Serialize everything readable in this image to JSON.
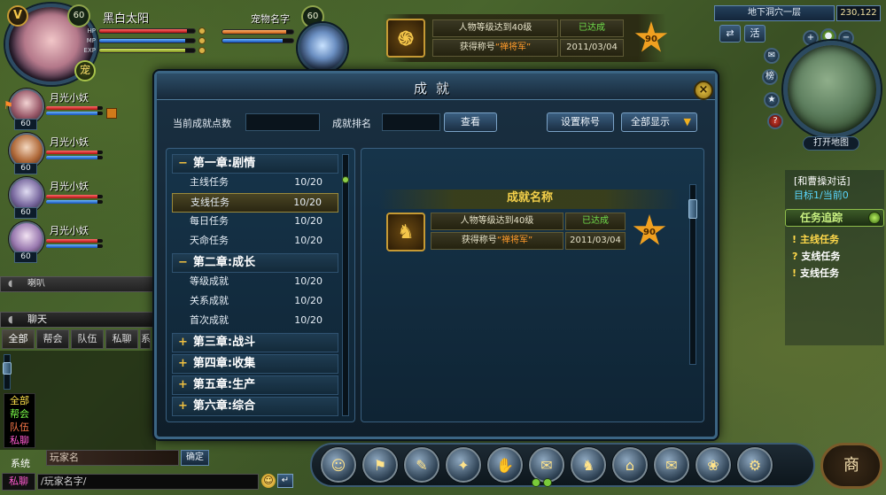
{
  "player": {
    "vip": "V",
    "level": "60",
    "name": "黑白太阳",
    "stat_labels": [
      "HP",
      "MP",
      "EXP"
    ],
    "hp_fraction": 0.92,
    "mp_fraction": 0.9,
    "exp_fraction": 0.9,
    "zhai_label": "宠"
  },
  "pet": {
    "name": "宠物名字",
    "level": "60",
    "hp_fraction": 0.9,
    "mp_fraction": 0.85
  },
  "party": [
    {
      "name": "月光小妖",
      "level": "60"
    },
    {
      "name": "月光小妖",
      "level": "60"
    },
    {
      "name": "月光小妖",
      "level": "60"
    },
    {
      "name": "月光小妖",
      "level": "60"
    }
  ],
  "notification": {
    "requirement": "人物等级达到40级",
    "status": "已达成",
    "reward_prefix": "获得称号",
    "reward_title": "“禅将军”",
    "date": "2011/03/04",
    "points": "90"
  },
  "minimap": {
    "location": "地下洞穴一层",
    "coords": "230,122",
    "button_left": "⇄",
    "button_right": "活",
    "side_buttons": [
      "榜",
      "?"
    ],
    "open_map_label": "打开地图"
  },
  "quest_tracker": {
    "talk": "[和曹操对话]",
    "target": "目标1/当前0",
    "track_label": "任务追踪",
    "items": [
      "主线任务",
      "支线任务",
      "支线任务"
    ]
  },
  "chat": {
    "collapsed_label": "喇叭",
    "header": "聊天",
    "tabs": [
      "全部",
      "帮会",
      "队伍",
      "私聊",
      "系"
    ],
    "filters": [
      {
        "label": "全部",
        "color": "#ffe14a"
      },
      {
        "label": "帮会",
        "color": "#7cff4a"
      },
      {
        "label": "队伍",
        "color": "#ff7a4a"
      },
      {
        "label": "私聊",
        "color": "#ff5ad0"
      },
      {
        "label": "系统",
        "color": "#ffffff"
      }
    ],
    "name_placeholder": "玩家名",
    "confirm_label": "确定",
    "channel_label": "私聊",
    "message_placeholder": "/玩家名字/"
  },
  "window": {
    "title": "成就",
    "points_label": "当前成就点数",
    "rank_label": "成就排名",
    "view_button": "查看",
    "set_title_button": "设置称号",
    "display_all_button": "全部显示",
    "chapters": [
      {
        "sign": "−",
        "title": "第一章:剧情",
        "items": [
          {
            "label": "主线任务",
            "progress": "10/20"
          },
          {
            "label": "支线任务",
            "progress": "10/20"
          },
          {
            "label": "每日任务",
            "progress": "10/20"
          },
          {
            "label": "天命任务",
            "progress": "10/20"
          }
        ]
      },
      {
        "sign": "−",
        "title": "第二章:成长",
        "items": [
          {
            "label": "等级成就",
            "progress": "10/20"
          },
          {
            "label": "关系成就",
            "progress": "10/20"
          },
          {
            "label": "首次成就",
            "progress": "10/20"
          }
        ]
      },
      {
        "sign": "+",
        "title": "第三章:战斗",
        "items": []
      },
      {
        "sign": "+",
        "title": "第四章:收集",
        "items": []
      },
      {
        "sign": "+",
        "title": "第五章:生产",
        "items": []
      },
      {
        "sign": "+",
        "title": "第六章:综合",
        "items": []
      }
    ],
    "achievement_header": "成就名称",
    "achievement": {
      "requirement": "人物等级达到40级",
      "status": "已达成",
      "reward_prefix": "获得称号",
      "reward_title": "“禅将军”",
      "date": "2011/03/04",
      "points": "90"
    }
  },
  "action_bar": {
    "icons": [
      "hero-icon",
      "bag-icon",
      "book-icon",
      "skill-icon",
      "handshake-icon",
      "scroll-icon",
      "pet-icon",
      "guild-icon",
      "mail-icon",
      "achievement-book-icon",
      "settings-gear-icon"
    ],
    "glyphs": [
      "☺",
      "⚑",
      "✎",
      "✦",
      "✋",
      "✉",
      "♞",
      "⌂",
      "✉",
      "❀",
      "⚙"
    ],
    "shop_label": "商"
  },
  "colors": {
    "accent_gold": "#f4d04a",
    "status_green": "#6fdc4a",
    "reward_orange": "#ff9a2a",
    "frame_blue": "#3b6584"
  }
}
